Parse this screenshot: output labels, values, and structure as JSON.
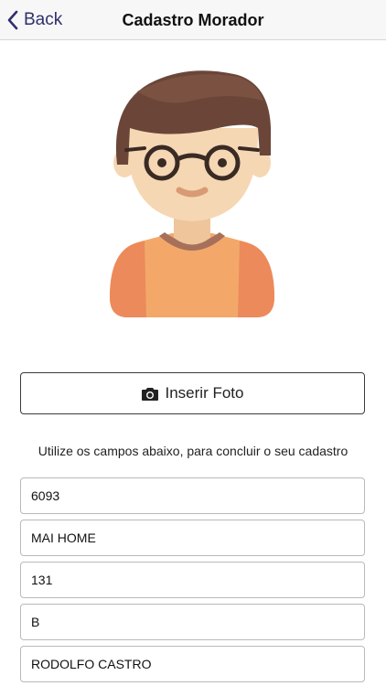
{
  "navbar": {
    "back_label": "Back",
    "title": "Cadastro Morador",
    "back_icon": "chevron-left-icon"
  },
  "avatar": {
    "icon": "user-avatar-illustration",
    "colors": {
      "hair": "#6b4638",
      "skin": "#f5d7b4",
      "shirt": "#f3a86a",
      "shirt_shadow": "#ec8a5b",
      "glasses": "#3a2a24"
    }
  },
  "photo_button": {
    "label": "Inserir Foto",
    "icon": "camera-icon"
  },
  "instruction": "Utilize os campos abaixo, para concluir o seu cadastro",
  "fields": [
    {
      "value": "6093"
    },
    {
      "value": "MAI HOME"
    },
    {
      "value": "131"
    },
    {
      "value": "B"
    },
    {
      "value": "RODOLFO CASTRO"
    }
  ]
}
